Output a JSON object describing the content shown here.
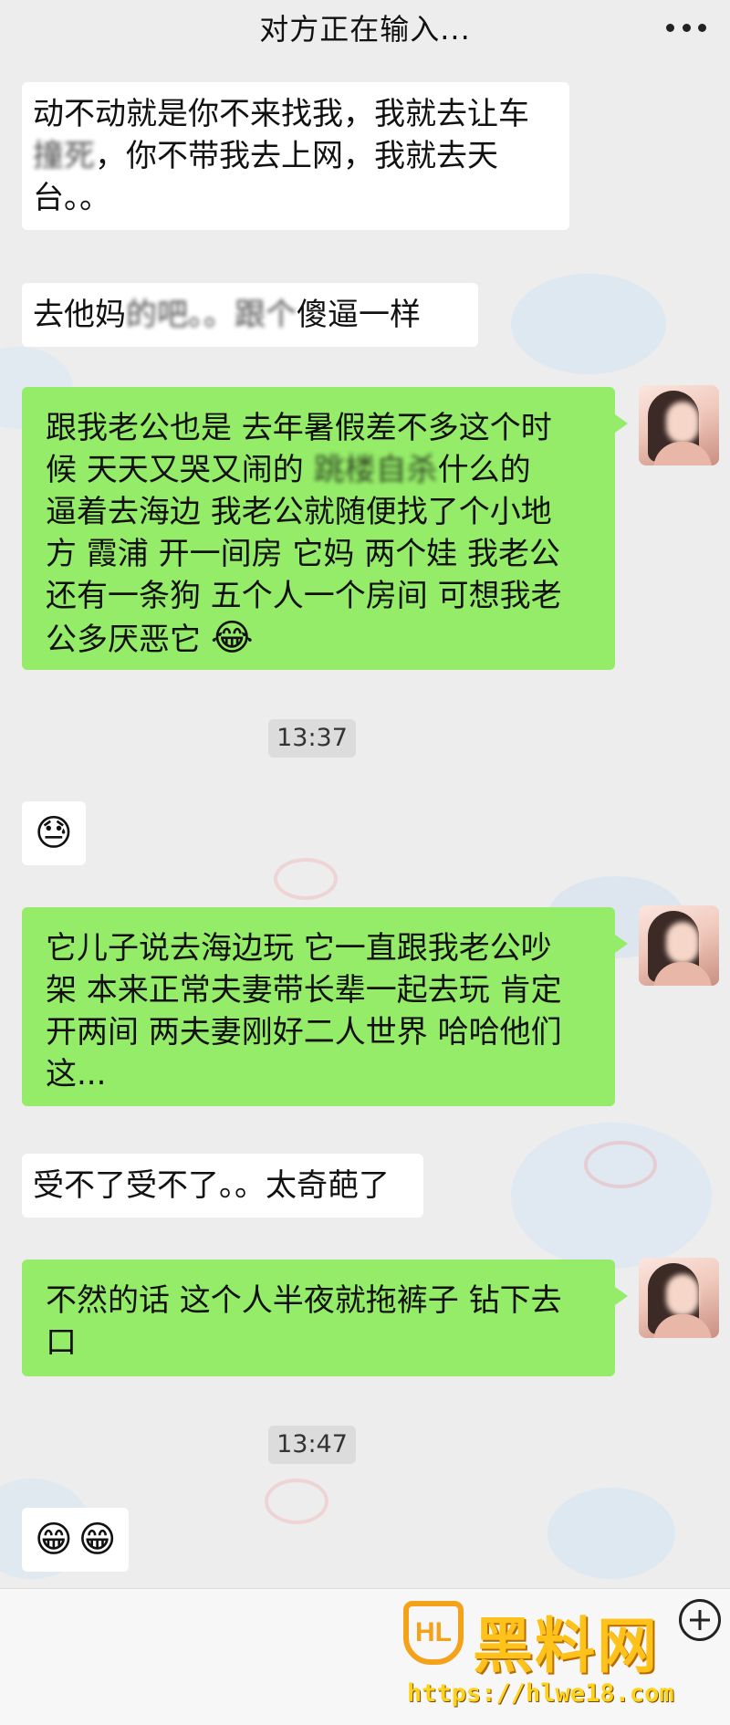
{
  "header": {
    "title": "对方正在输入..."
  },
  "messages": [
    {
      "side": "left",
      "text_visible": "动不动就是你不来找我，我就去让车",
      "line2_blur": "撞死",
      "line2_rest": "，你不带我去上网，我就去天",
      "line3": "台。。"
    },
    {
      "side": "left",
      "text_a": "去他妈",
      "text_blur": "的吧。。跟个",
      "text_b": "傻逼一样"
    },
    {
      "side": "right",
      "lines": [
        "跟我老公也是 去年暑假差不多这个时",
        "候 天天又哭又闹的 ",
        "跳楼自杀",
        "什么的",
        "逼着去海边 我老公就随便找了个小地",
        "方 霞浦 开一间房 它妈 两个娃 我老公",
        "还有一条狗 五个人一个房间 可想我老",
        "公多厌恶它 "
      ],
      "emoji": "😂"
    },
    {
      "side": "right",
      "lines": [
        "它儿子说去海边玩 它一直跟我老公吵",
        "架 本来正常夫妻带长辈一起去玩 肯定",
        "开两间 两夫妻刚好二人世界 哈哈他们",
        "这..."
      ]
    },
    {
      "side": "left",
      "text": "受不了受不了。。太奇葩了"
    },
    {
      "side": "right",
      "lines": [
        "不然的话 这个人半夜就拖裤子 钻下去",
        "口"
      ]
    }
  ],
  "times": [
    "13:37",
    "13:47"
  ],
  "emoji_msgs": [
    [
      "😓"
    ],
    [
      "😁",
      "😁"
    ]
  ],
  "watermark": {
    "logo": "HL",
    "name": "黑料网",
    "url": "https://hlwe18.com"
  },
  "colors": {
    "bubble_green": "#95ec69",
    "bubble_white": "#ffffff",
    "background": "#ededed"
  }
}
